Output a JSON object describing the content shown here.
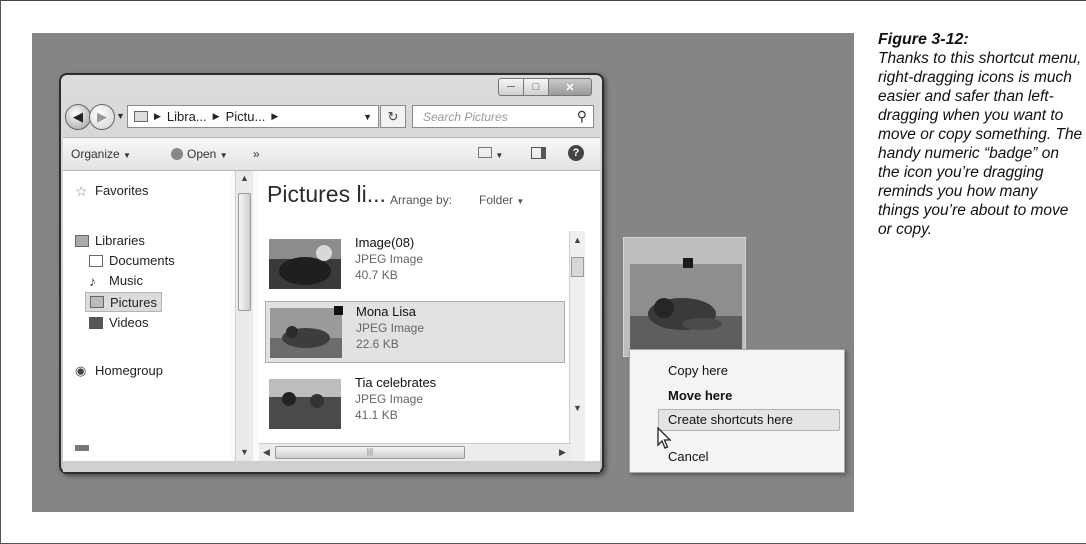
{
  "caption": {
    "title": "Figure 3-12:",
    "body": "Thanks to this shortcut menu, right-dragging icons is much easier and safer than left-dragging when you want to move or copy something. The handy numeric “badge” on the icon you’re dragging reminds you how many things you’re about to move or copy."
  },
  "window": {
    "breadcrumb": [
      "Libra...",
      "Pictu..."
    ],
    "search_placeholder": "Search Pictures",
    "toolbar": {
      "organize": "Organize",
      "open": "Open",
      "more": "»"
    },
    "nav": {
      "favorites": "Favorites",
      "libraries": "Libraries",
      "documents": "Documents",
      "music": "Music",
      "pictures": "Pictures",
      "videos": "Videos",
      "homegroup": "Homegroup"
    },
    "folder_title": "Pictures li...",
    "arrange_by": "Arrange by:",
    "arrange_value": "Folder",
    "files": [
      {
        "name": "Image(08)",
        "type": "JPEG Image",
        "size": "40.7 KB"
      },
      {
        "name": "Mona Lisa",
        "type": "JPEG Image",
        "size": "22.6 KB"
      },
      {
        "name": "Tia celebrates",
        "type": "JPEG Image",
        "size": "41.1 KB"
      }
    ]
  },
  "context_menu": {
    "items": [
      "Copy here",
      "Move here",
      "Create shortcuts here",
      "Cancel"
    ],
    "default_item": "Move here",
    "highlighted_item": "Create shortcuts here"
  }
}
